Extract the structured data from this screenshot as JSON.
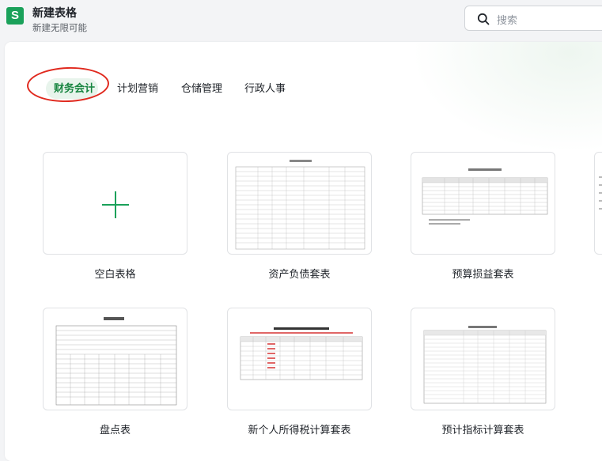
{
  "header": {
    "app_icon_letter": "S",
    "title": "新建表格",
    "subtitle": "新建无限可能",
    "search_placeholder": "搜索",
    "search_icon": "search-icon"
  },
  "tabs": [
    {
      "label": "财务会计",
      "active": true
    },
    {
      "label": "计划营销",
      "active": false
    },
    {
      "label": "仓储管理",
      "active": false
    },
    {
      "label": "行政人事",
      "active": false
    }
  ],
  "templates": [
    {
      "label": "空白表格",
      "thumb": "plus-icon"
    },
    {
      "label": "资产负债套表",
      "thumb": "sheet-preview"
    },
    {
      "label": "预算损益套表",
      "thumb": "sheet-preview"
    },
    {
      "label": "盘点表",
      "thumb": "sheet-preview"
    },
    {
      "label": "新个人所得税计算套表",
      "thumb": "sheet-preview"
    },
    {
      "label": "预计指标计算套表",
      "thumb": "sheet-preview"
    }
  ],
  "colors": {
    "brand_green": "#1aa15a",
    "active_tab_text": "#16843f",
    "annotation_red": "#e0291e"
  }
}
